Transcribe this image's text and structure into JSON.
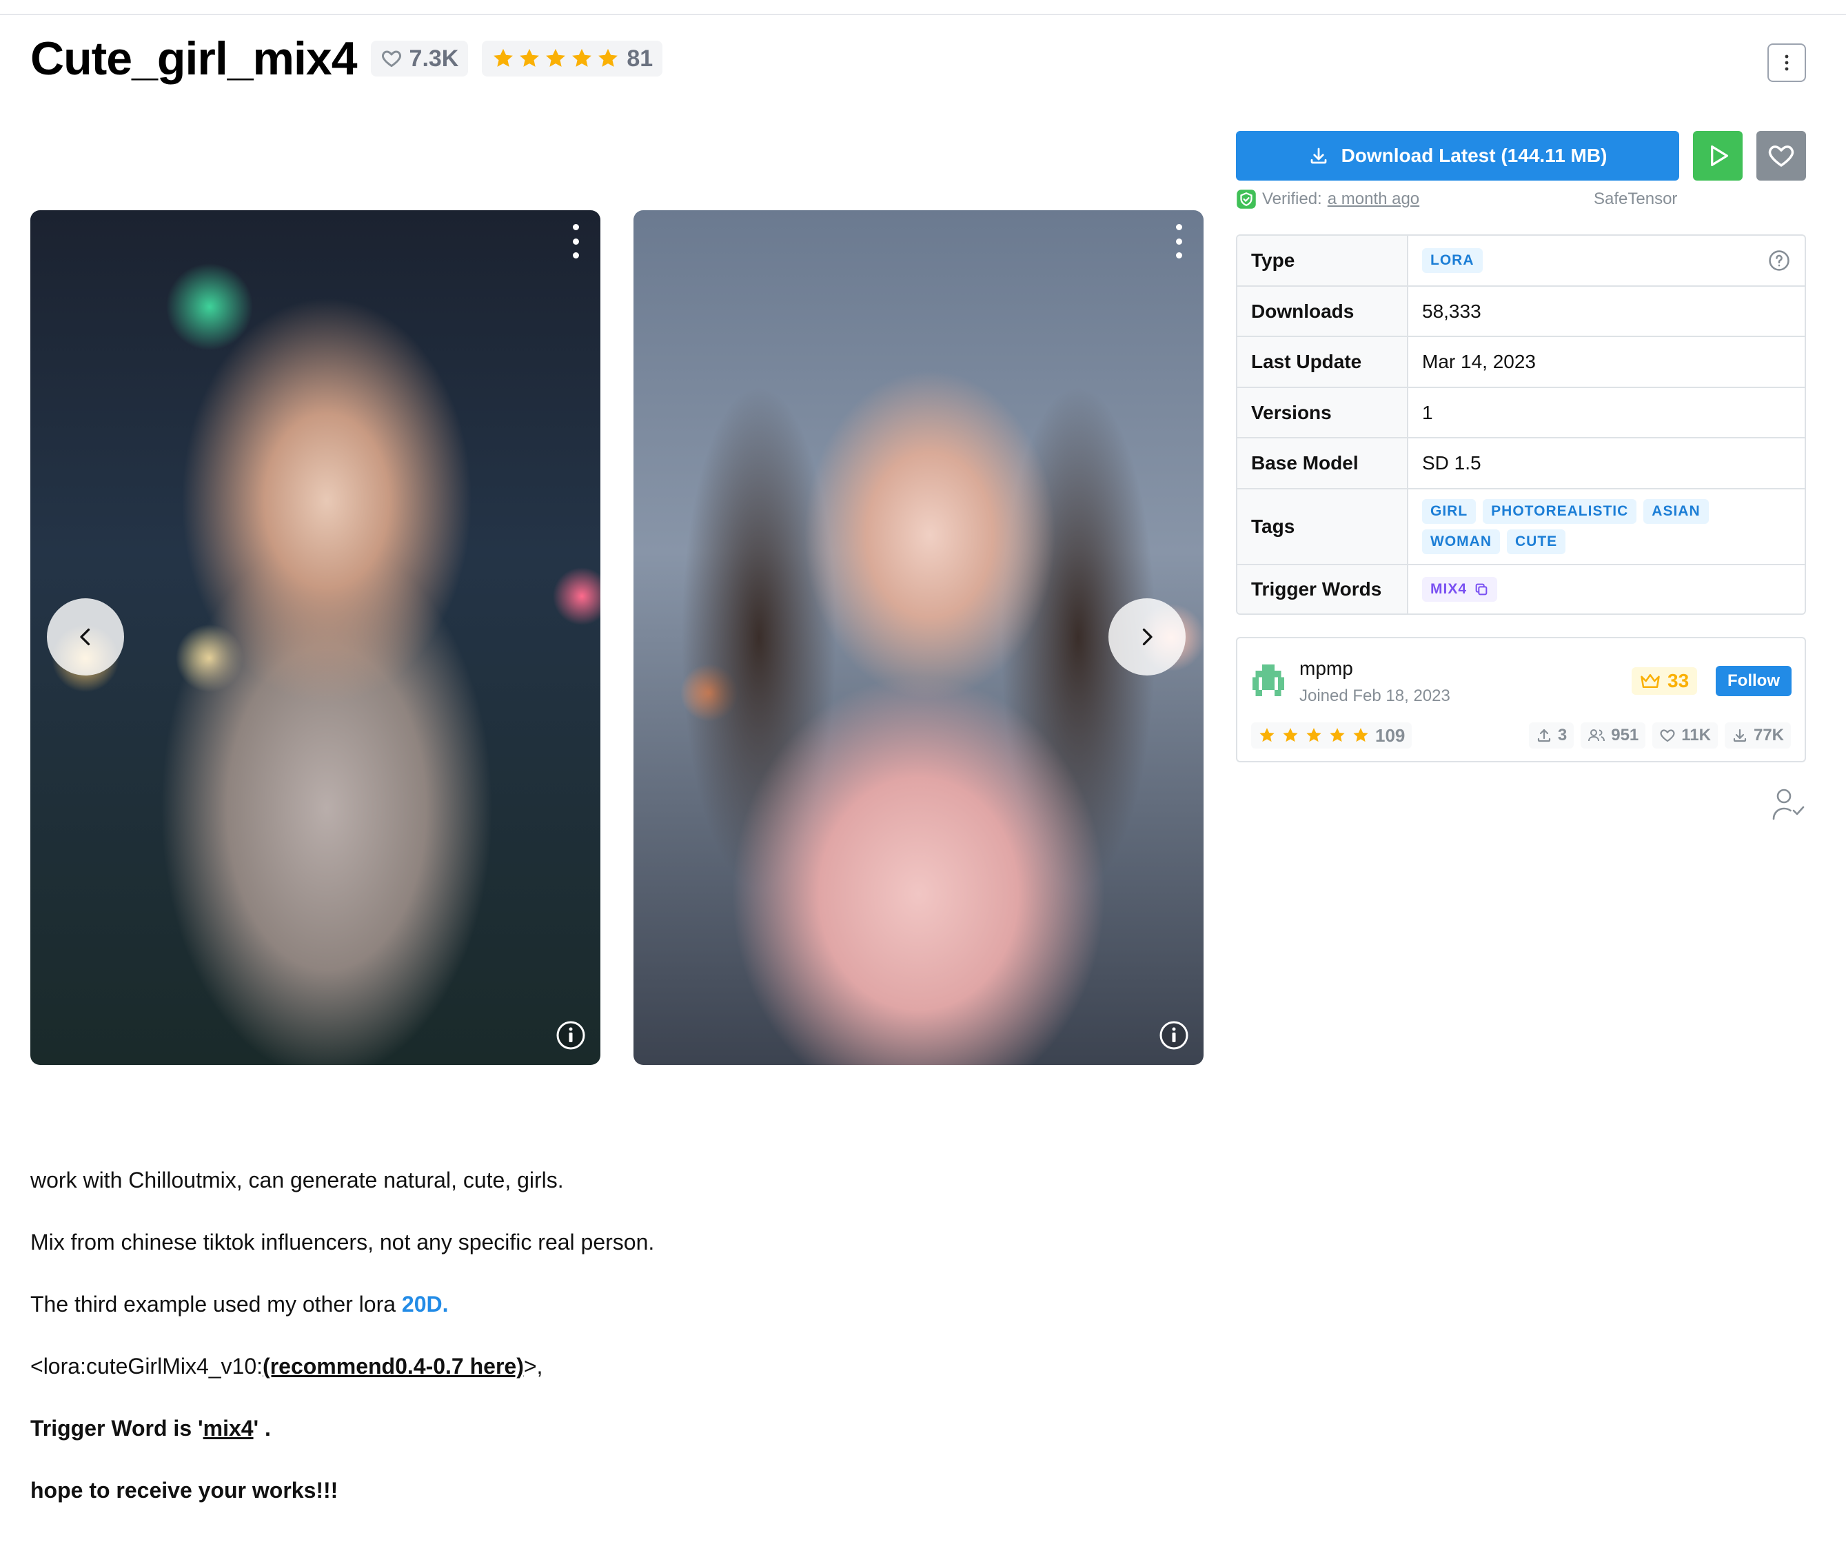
{
  "header": {
    "title": "Cute_girl_mix4",
    "favorites": "7.3K",
    "rating_count": "81"
  },
  "actions": {
    "download_label": "Download Latest (144.11 MB)",
    "verified_prefix": "Verified:",
    "verified_when": "a month ago",
    "format": "SafeTensor"
  },
  "details": {
    "type_label": "Type",
    "type_value": "LORA",
    "downloads_label": "Downloads",
    "downloads_value": "58,333",
    "last_update_label": "Last Update",
    "last_update_value": "Mar 14, 2023",
    "versions_label": "Versions",
    "versions_value": "1",
    "base_model_label": "Base Model",
    "base_model_value": "SD 1.5",
    "tags_label": "Tags",
    "tags": [
      "GIRL",
      "PHOTOREALISTIC",
      "ASIAN",
      "WOMAN",
      "CUTE"
    ],
    "trigger_label": "Trigger Words",
    "trigger_value": "MIX4"
  },
  "creator": {
    "name": "mpmp",
    "joined": "Joined Feb 18, 2023",
    "crowns": "33",
    "follow_label": "Follow",
    "rating_count": "109",
    "uploads": "3",
    "followers": "951",
    "likes": "11K",
    "downloads": "77K"
  },
  "description": {
    "p1": "work with Chilloutmix, can generate natural, cute, girls.",
    "p2": "Mix from chinese tiktok influencers, not any specific real person.",
    "p3_text": "The third example used my other lora ",
    "p3_link": "20D.",
    "p4_prefix": "<lora:cuteGirlMix4_v10:",
    "p4_link": "(recommend0.4-0.7 here)",
    "p4_suffix": ">,",
    "p5_prefix": "Trigger Word is '",
    "p5_word": "mix4",
    "p5_suffix": "' .",
    "p6": "hope to receive your works!!!"
  },
  "colors": {
    "primary": "#228be6",
    "success": "#40c057",
    "gray": "#868e96",
    "star": "#fab005"
  }
}
